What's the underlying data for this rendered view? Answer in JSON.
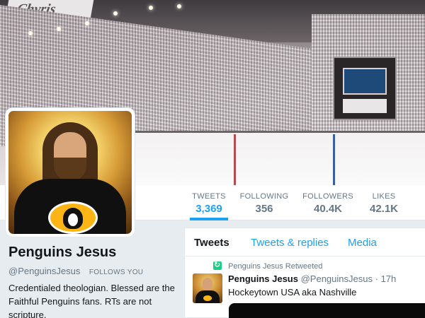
{
  "banner": {
    "sign_text": "Chyris"
  },
  "stats": [
    {
      "label": "TWEETS",
      "value": "3,369",
      "active": true
    },
    {
      "label": "FOLLOWING",
      "value": "356",
      "active": false
    },
    {
      "label": "FOLLOWERS",
      "value": "40.4K",
      "active": false
    },
    {
      "label": "LIKES",
      "value": "42.1K",
      "active": false
    }
  ],
  "profile": {
    "name": "Penguins Jesus",
    "handle": "@PenguinsJesus",
    "follows_you": "FOLLOWS YOU",
    "bio": "Credentialed theologian. Blessed are the Faithful Penguins fans. RTs are not scripture."
  },
  "tabs": [
    {
      "label": "Tweets",
      "active": true
    },
    {
      "label": "Tweets & replies",
      "active": false
    },
    {
      "label": "Media",
      "active": false
    }
  ],
  "tweet": {
    "retweet_label": "Penguins Jesus Retweeted",
    "author_name": "Penguins Jesus",
    "author_handle": "@PenguinsJesus",
    "separator": "·",
    "time": "17h",
    "text": "Hockeytown USA aka Nashville"
  },
  "colors": {
    "accent": "#1da1f2",
    "retweet_green": "#19cf86",
    "muted": "#657786"
  },
  "icons": {
    "retweet": "retweet-icon"
  }
}
